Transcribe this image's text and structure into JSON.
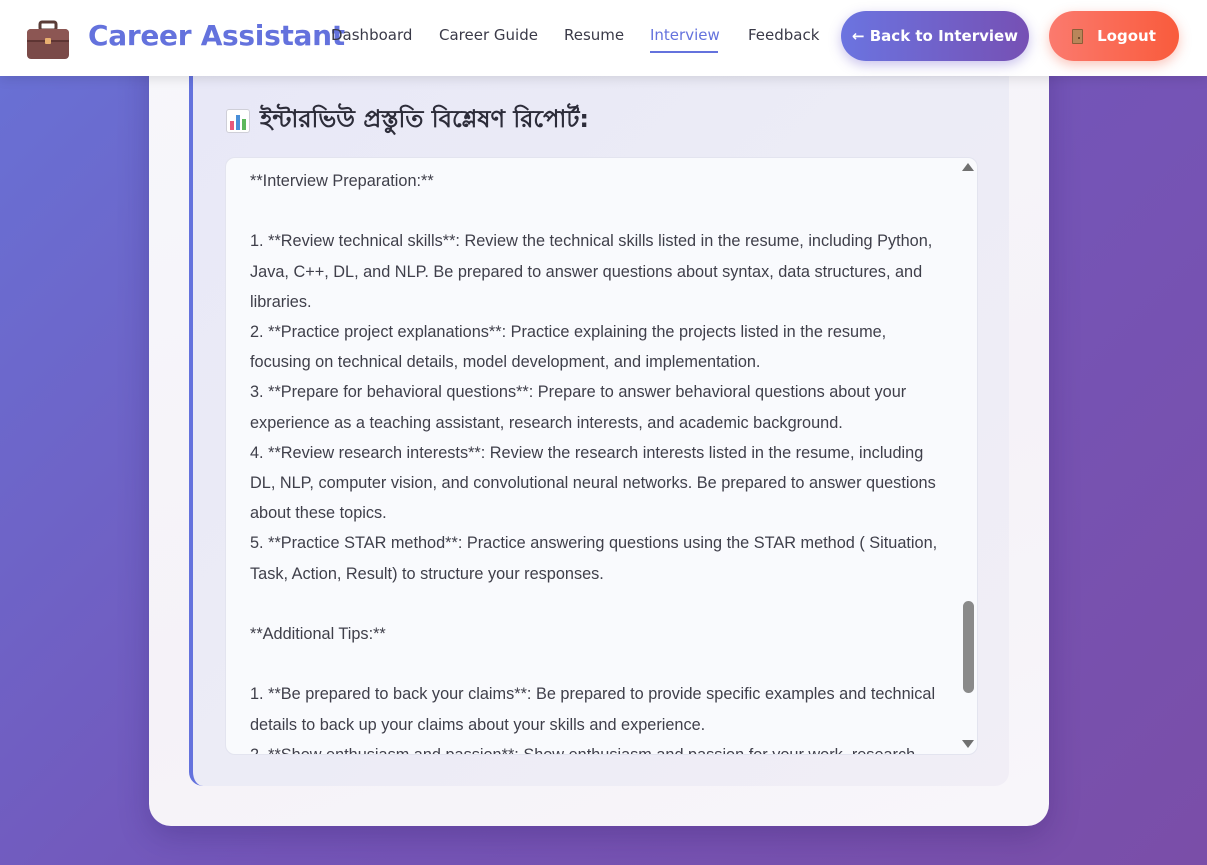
{
  "header": {
    "brand_icon": "briefcase-icon",
    "brand_title": "Career Assistant",
    "nav": [
      {
        "label": "Dashboard",
        "active": false
      },
      {
        "label": "Career Guide",
        "active": false
      },
      {
        "label": "Resume",
        "active": false
      },
      {
        "label": "Interview",
        "active": true
      },
      {
        "label": "Feedback",
        "active": false
      }
    ],
    "back_button": "← Back to Interview",
    "logout_button": "Logout",
    "logout_icon": "door-icon"
  },
  "colors": {
    "accent": "#6472dd",
    "back_gradient": [
      "#6b74e0",
      "#7650b4"
    ],
    "logout_gradient": [
      "#fb7a6e",
      "#f95b3c"
    ],
    "background_gradient": [
      "#6872d6",
      "#7a4ea8"
    ]
  },
  "report": {
    "heading_icon": "bar-chart-icon",
    "heading": "ইন্টারভিউ প্রস্তুতি বিশ্লেষণ রিপোর্ট:",
    "lines": [
      "**Interview Preparation:**",
      "",
      "1. **Review technical skills**: Review the technical skills listed in the resume, including Python, Java, C++, DL, and NLP. Be prepared to answer questions about syntax, data structures, and libraries.",
      "2. **Practice project explanations**: Practice explaining the projects listed in the resume, focusing on technical details, model development, and implementation.",
      "3. **Prepare for behavioral questions**: Prepare to answer behavioral questions about your experience as a teaching assistant, research interests, and academic background.",
      "4. **Review research interests**: Review the research interests listed in the resume, including DL, NLP, computer vision, and convolutional neural networks. Be prepared to answer questions about these topics.",
      "5. **Practice STAR method**: Practice answering questions using the STAR method ( Situation, Task, Action, Result) to structure your responses.",
      "",
      "**Additional Tips:**",
      "",
      "1. **Be prepared to back your claims**: Be prepared to provide specific examples and technical details to back up your claims about your skills and experience.",
      "2. **Show enthusiasm and passion**: Show enthusiasm and passion for your work, research"
    ]
  }
}
